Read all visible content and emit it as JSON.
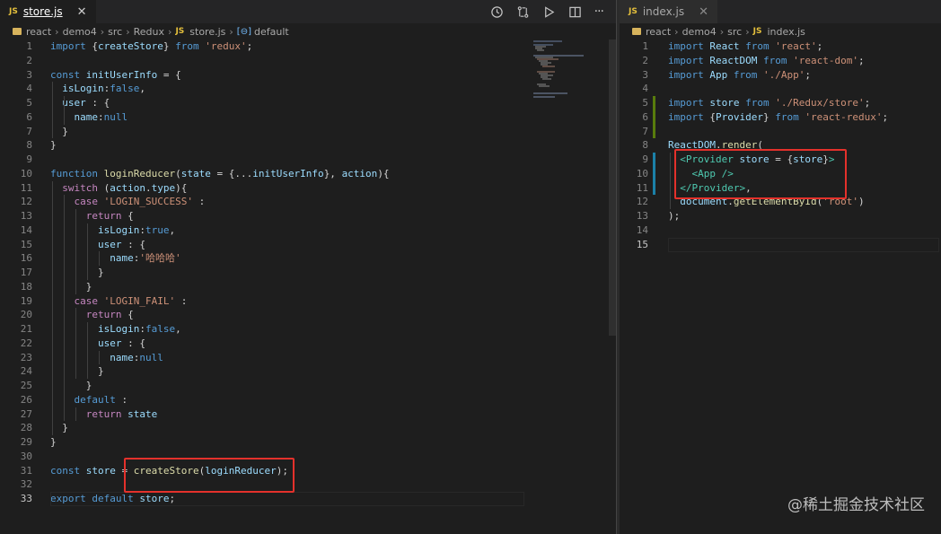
{
  "left_editor": {
    "tab": {
      "label": "store.js",
      "badge": "JS",
      "close": "✕"
    },
    "breadcrumb": {
      "parts": [
        "react",
        "demo4",
        "src",
        "Redux",
        "store.js",
        "default"
      ]
    },
    "code_lines": [
      "import {createStore} from 'redux';",
      "",
      "const initUserInfo = {",
      "  isLogin:false,",
      "  user : {",
      "    name:null",
      "  }",
      "}",
      "",
      "function loginReducer(state = {...initUserInfo}, action){",
      "  switch (action.type){",
      "    case 'LOGIN_SUCCESS' :",
      "      return {",
      "        isLogin:true,",
      "        user : {",
      "          name:'哈哈哈'",
      "        }",
      "      }",
      "    case 'LOGIN_FAIL' :",
      "      return {",
      "        isLogin:false,",
      "        user : {",
      "          name:null",
      "        }",
      "      }",
      "    default :",
      "      return state",
      "  }",
      "}",
      "",
      "const store = createStore(loginReducer);",
      "",
      "export default store;"
    ]
  },
  "right_editor": {
    "tab": {
      "label": "index.js",
      "badge": "JS",
      "close": "✕"
    },
    "breadcrumb": {
      "parts": [
        "react",
        "demo4",
        "src",
        "index.js"
      ]
    },
    "code_lines": [
      "import React from 'react';",
      "import ReactDOM from 'react-dom';",
      "import App from './App';",
      "",
      "import store from './Redux/store';",
      "import {Provider} from 'react-redux';",
      "",
      "ReactDOM.render(",
      "  <Provider store = {store}>",
      "    <App />",
      "  </Provider>,",
      "  document.getElementById('root')",
      ");",
      "",
      ""
    ]
  },
  "toolbar": {
    "icons": [
      "history-icon",
      "compare-changes-icon",
      "run-icon",
      "split-editor-icon",
      "more-actions-icon"
    ],
    "more_label": "···"
  },
  "watermark": "@稀土掘金技术社区",
  "colors": {
    "highlight_box": "#e4312b",
    "background": "#1e1e1e",
    "modified_gutter": "#1b81a8",
    "added_gutter": "#587c0c"
  }
}
